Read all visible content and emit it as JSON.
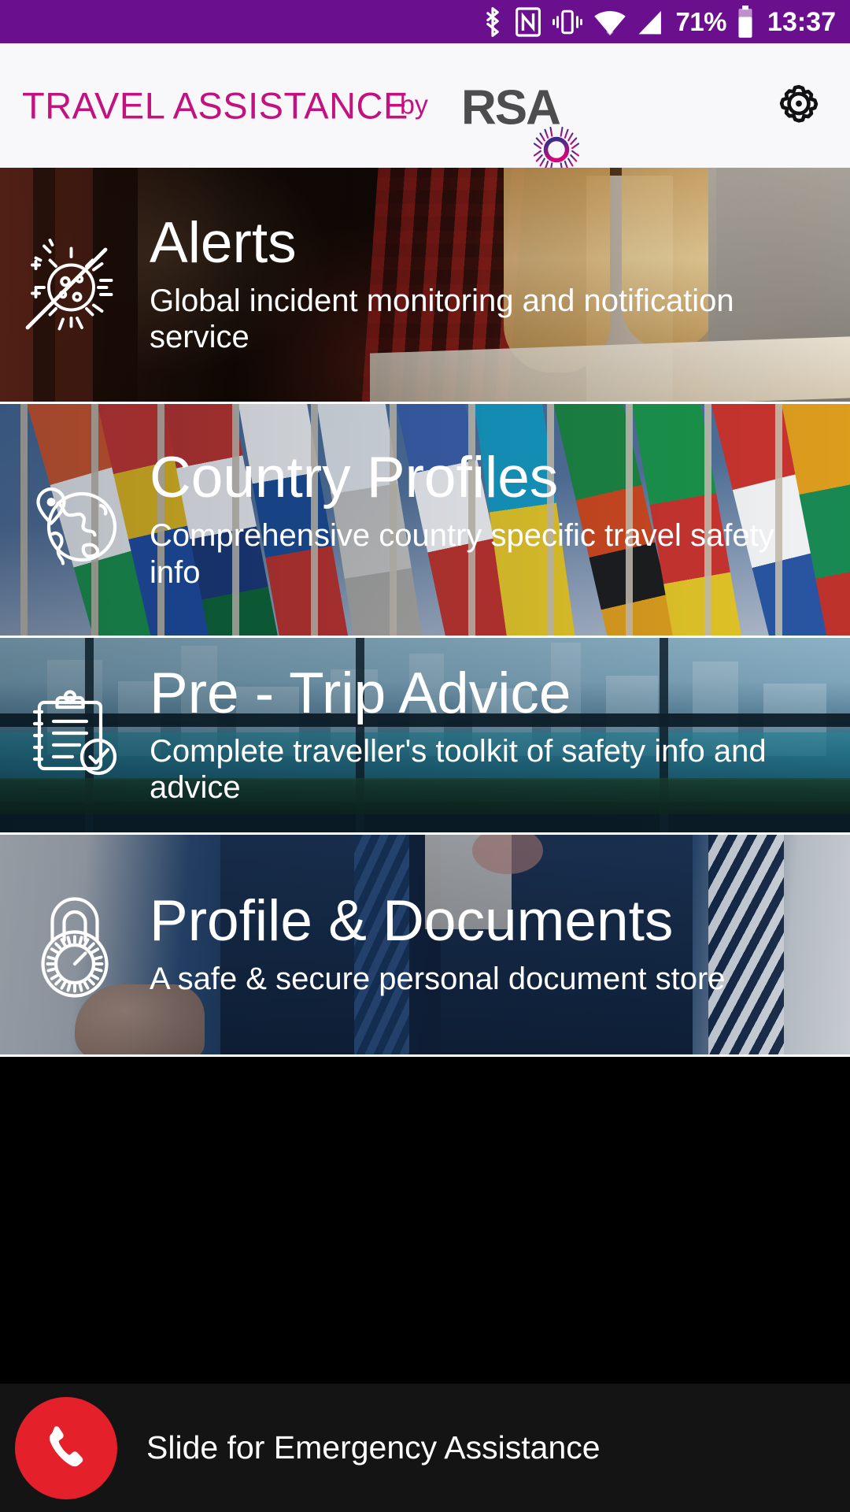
{
  "statusbar": {
    "battery_percent": "71%",
    "clock": "13:37",
    "icons": [
      "bluetooth-icon",
      "nfc-icon",
      "vibrate-icon",
      "wifi-icon",
      "cellular-signal-icon",
      "battery-icon"
    ],
    "background_color": "#6A0F8E"
  },
  "header": {
    "app_title": "TRAVEL ASSISTANCE",
    "by_label": "by",
    "brand": "RSA",
    "title_color": "#C2127F",
    "background_color": "#F8F8FA",
    "settings_icon": "gear-icon"
  },
  "cards": [
    {
      "id": "alerts",
      "title": "Alerts",
      "subtitle": "Global incident monitoring and notification service",
      "icon": "sun-crossed-alert-icon"
    },
    {
      "id": "country-profiles",
      "title": "Country Profiles",
      "subtitle": "Comprehensive country specific travel safety info",
      "icon": "globe-location-pin-icon"
    },
    {
      "id": "pre-trip-advice",
      "title": "Pre - Trip Advice",
      "subtitle": "Complete traveller's toolkit of safety info and advice",
      "icon": "clipboard-checklist-icon"
    },
    {
      "id": "profile-documents",
      "title": "Profile & Documents",
      "subtitle": "A safe & secure personal document store",
      "icon": "combination-padlock-icon"
    }
  ],
  "bottom_bar": {
    "label": "Slide for Emergency Assistance",
    "call_icon": "phone-icon",
    "call_button_color": "#E4202A",
    "background_color": "#141414"
  }
}
